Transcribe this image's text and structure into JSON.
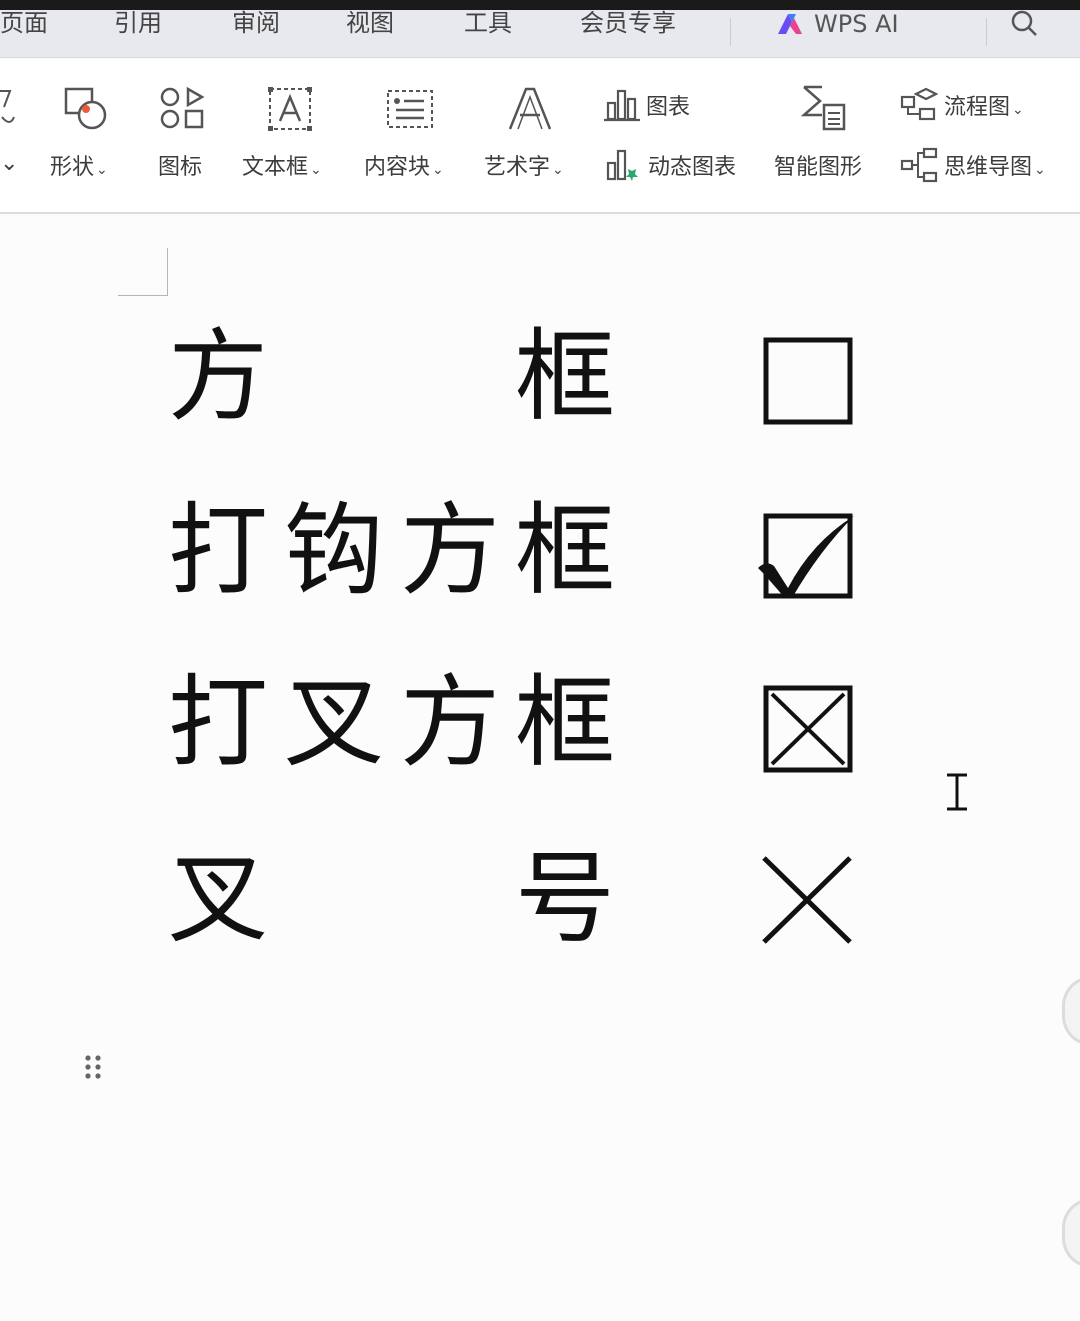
{
  "menubar": {
    "items": [
      "页面",
      "引用",
      "审阅",
      "视图",
      "工具",
      "会员专享"
    ],
    "wps_ai_label": "WPS AI"
  },
  "ribbon": {
    "shape_label": "形状",
    "icons_label": "图标",
    "textbox_label": "文本框",
    "content_block_label": "内容块",
    "wordart_label": "艺术字",
    "chart_label": "图表",
    "dynamic_chart_label": "动态图表",
    "smart_shape_label": "智能图形",
    "flowchart_label": "流程图",
    "mindmap_label": "思维导图"
  },
  "document": {
    "rows": [
      {
        "chars": [
          "方",
          "框"
        ],
        "symbol": "empty-box-icon"
      },
      {
        "chars": [
          "打",
          "钩",
          "方",
          "框"
        ],
        "symbol": "checked-box-icon"
      },
      {
        "chars": [
          "打",
          "叉",
          "方",
          "框"
        ],
        "symbol": "crossed-box-icon"
      },
      {
        "chars": [
          "叉",
          "号"
        ],
        "symbol": "cross-mark-icon"
      }
    ]
  }
}
